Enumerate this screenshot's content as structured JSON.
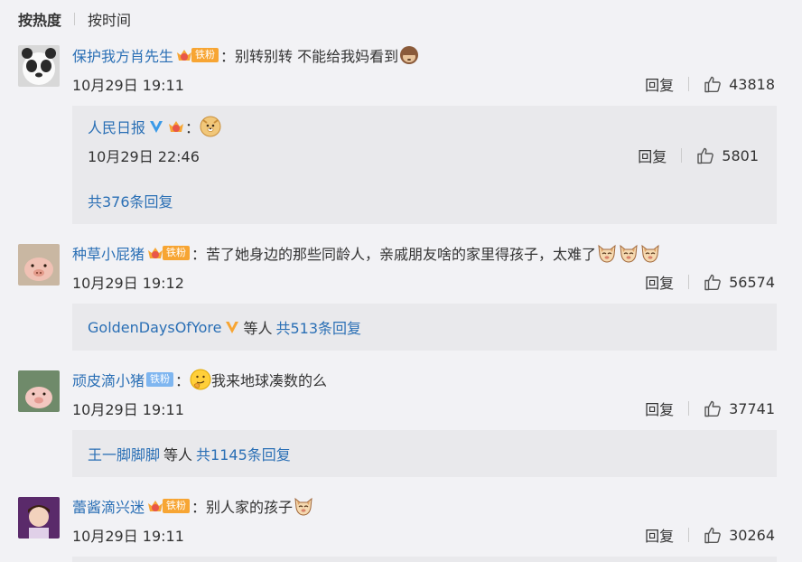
{
  "sort": {
    "active": "按热度",
    "other": "按时间"
  },
  "comments": [
    {
      "username": "保护我方肖先生",
      "fan_level": "2",
      "fan_label": "铁粉",
      "colon": "：",
      "text": "别转别转 不能给我妈看到",
      "emoji": "see-no-evil-monkey",
      "date": "10月29日 19:11",
      "reply_label": "回复",
      "likes": "43818",
      "reply_box": {
        "username": "人民日报",
        "fan_level": "5",
        "colon": "：",
        "emoji": "doge",
        "date": "10月29日 22:46",
        "reply_label": "回复",
        "likes": "5801",
        "more": "共376条回复"
      }
    },
    {
      "username": "种草小屁猪",
      "fan_level": "3",
      "fan_label": "铁粉",
      "colon": "：",
      "text": "苦了她身边的那些同龄人，亲戚朋友啥的家里得孩子，太难了",
      "emoji": "cat-face",
      "date": "10月29日 19:12",
      "reply_label": "回复",
      "likes": "56574",
      "reply_summary": {
        "user": "GoldenDaysOfYore",
        "mid": "等人",
        "more": "共513条回复"
      }
    },
    {
      "username": "顽皮滴小猪",
      "fan_label": "铁粉",
      "colon": "：",
      "text": "我来地球凑数的么",
      "emoji": "thinking-face",
      "date": "10月29日 19:11",
      "reply_label": "回复",
      "likes": "37741",
      "reply_summary": {
        "user": "王一脚脚脚",
        "mid": "等人",
        "more": "共1145条回复"
      }
    },
    {
      "username": "蕾酱滴兴迷",
      "fan_level": "2",
      "fan_label": "铁粉",
      "colon": "：",
      "text": "别人家的孩子",
      "emoji": "cat-face",
      "date": "10月29日 19:11",
      "reply_label": "回复",
      "likes": "30264"
    }
  ],
  "colors": {
    "link": "#2a6fb5",
    "background": "#f2f2f5",
    "reply_box": "#e9e9ec",
    "verified": "#f7a533",
    "fan_badge": "#f7a533"
  }
}
